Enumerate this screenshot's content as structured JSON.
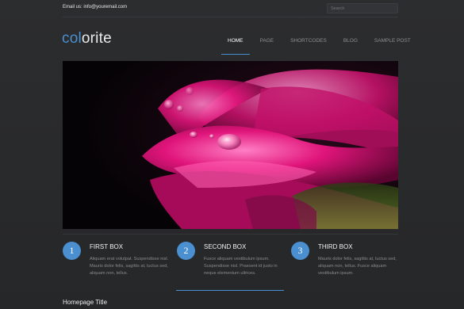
{
  "topbar": {
    "email": "Email us: info@youremail.com",
    "search_placeholder": "Search"
  },
  "logo": {
    "part1": "col",
    "part2": "orite"
  },
  "nav": {
    "items": [
      {
        "label": "HOME"
      },
      {
        "label": "PAGE"
      },
      {
        "label": "SHORTCODES"
      },
      {
        "label": "BLOG"
      },
      {
        "label": "SAMPLE POST"
      }
    ],
    "active": "HOME"
  },
  "hero": {
    "subject": "macro photo of a pink gerbera flower with water droplets"
  },
  "boxes": [
    {
      "number": "1",
      "title": "FIRST BOX",
      "text": "Aliquam erat volutpat. Suspendisse nisl. Mauris dolor felis, sagittis at, luctus sed, aliquam non, tellus."
    },
    {
      "number": "2",
      "title": "SECOND BOX",
      "text": "Fusce aliquam vestibulum ipsum. Suspendisse nisl. Praesent id justo in neque elementum ultrices."
    },
    {
      "number": "3",
      "title": "THIRD BOX",
      "text": "Mauris dolor felis, sagittis at, luctus sed, aliquam non, tellus. Fusce aliquam vestibulum ipsum."
    }
  ],
  "section": {
    "title": "Homepage Title"
  },
  "colors": {
    "accent": "#4a8fd0",
    "background": "#2a2b2d",
    "flower": "#e0147a"
  }
}
